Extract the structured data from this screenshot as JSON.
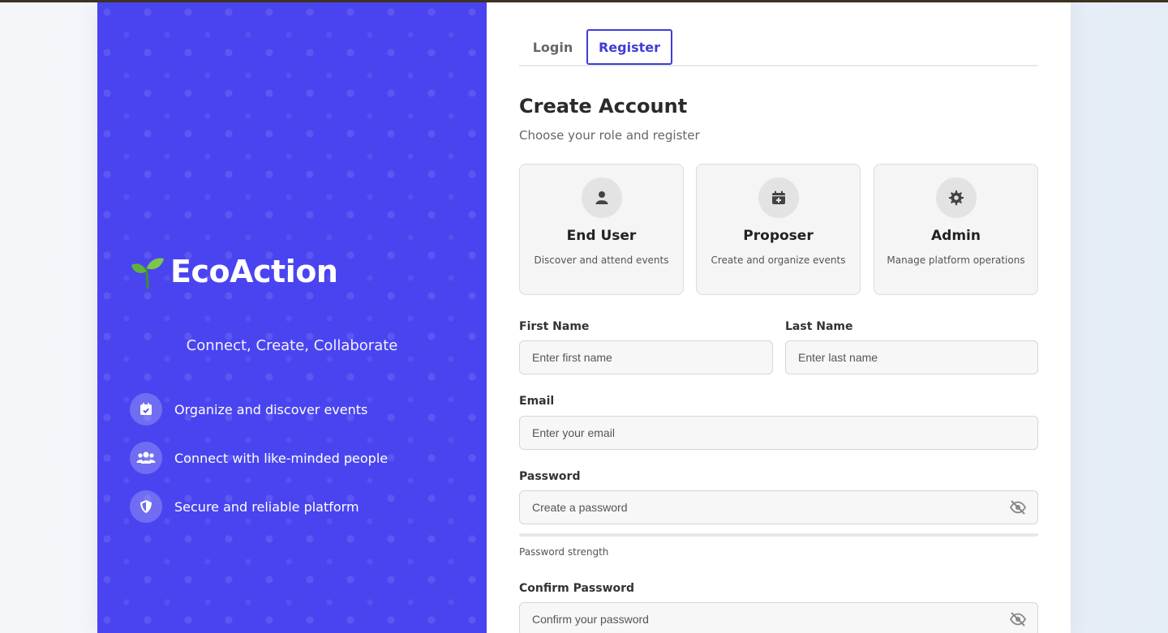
{
  "brand": {
    "name": "EcoAction",
    "tagline": "Connect, Create, Collaborate"
  },
  "features": [
    {
      "label": "Organize and discover events",
      "icon": "calendar-check-icon"
    },
    {
      "label": "Connect with like-minded people",
      "icon": "users-icon"
    },
    {
      "label": "Secure and reliable platform",
      "icon": "shield-icon"
    }
  ],
  "tabs": {
    "login": "Login",
    "register": "Register",
    "active": "register"
  },
  "form": {
    "title": "Create Account",
    "subtitle": "Choose your role and register",
    "roles": [
      {
        "title": "End User",
        "desc": "Discover and attend events",
        "icon": "user-icon"
      },
      {
        "title": "Proposer",
        "desc": "Create and organize events",
        "icon": "calendar-plus-icon"
      },
      {
        "title": "Admin",
        "desc": "Manage platform operations",
        "icon": "gear-icon"
      }
    ],
    "first_name": {
      "label": "First Name",
      "placeholder": "Enter first name",
      "value": ""
    },
    "last_name": {
      "label": "Last Name",
      "placeholder": "Enter last name",
      "value": ""
    },
    "email": {
      "label": "Email",
      "placeholder": "Enter your email",
      "value": ""
    },
    "password": {
      "label": "Password",
      "placeholder": "Create a password",
      "value": "",
      "strength_label": "Password strength"
    },
    "confirm_password": {
      "label": "Confirm Password",
      "placeholder": "Confirm your password",
      "value": ""
    }
  },
  "colors": {
    "brand": "#4a44f0",
    "accent": "#3f3dd6",
    "text": "#2a2a2a"
  }
}
